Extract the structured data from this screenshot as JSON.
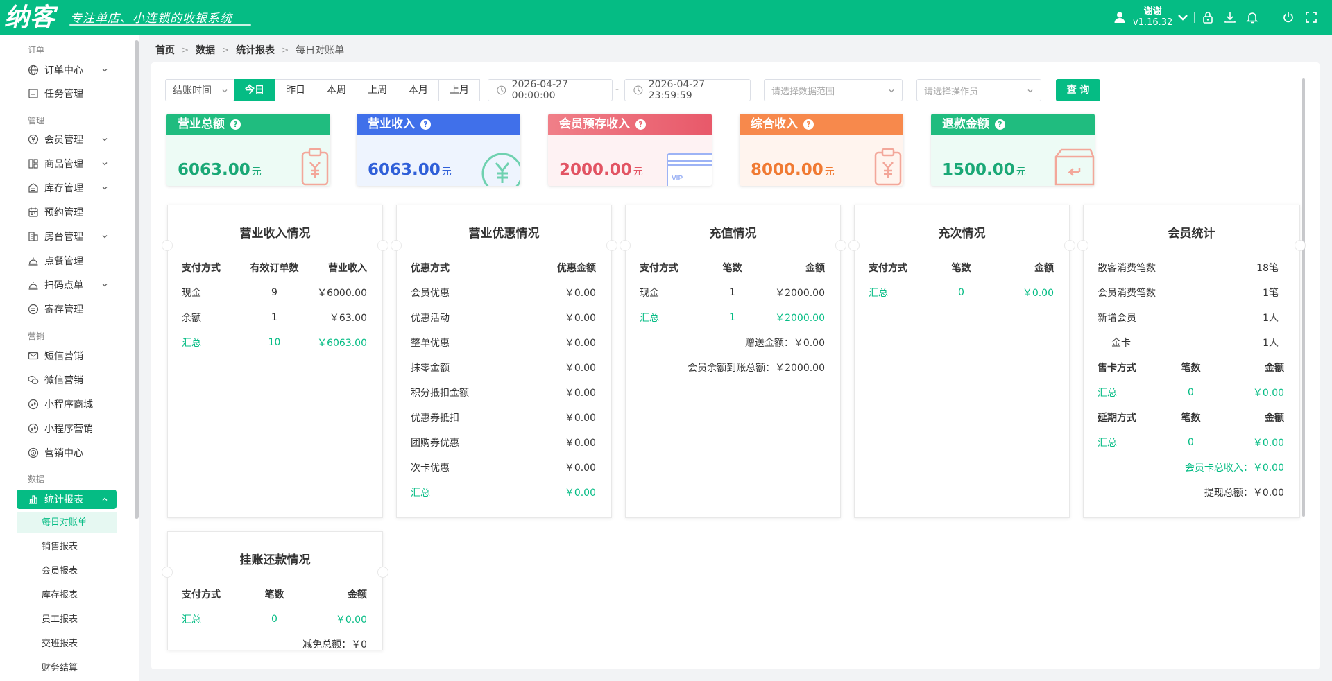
{
  "header": {
    "logo": "纳客",
    "slogan": "专注单店、小连锁的收银系统",
    "user": "谢谢",
    "version": "v1.16.32"
  },
  "sidebar": {
    "groups": [
      "订单",
      "管理",
      "营销",
      "数据"
    ],
    "items": [
      {
        "label": "订单中心",
        "icon": "globe-icon",
        "chevron": true
      },
      {
        "label": "任务管理",
        "icon": "task-icon",
        "chevron": false
      },
      {
        "label": "会员管理",
        "icon": "yen-icon",
        "chevron": true
      },
      {
        "label": "商品管理",
        "icon": "product-icon",
        "chevron": true
      },
      {
        "label": "库存管理",
        "icon": "warehouse-icon",
        "chevron": true
      },
      {
        "label": "预约管理",
        "icon": "calendar-icon",
        "chevron": false
      },
      {
        "label": "房台管理",
        "icon": "building-icon",
        "chevron": true
      },
      {
        "label": "点餐管理",
        "icon": "dining-icon",
        "chevron": false
      },
      {
        "label": "扫码点单",
        "icon": "dining-icon",
        "chevron": true
      },
      {
        "label": "寄存管理",
        "icon": "deposit-icon",
        "chevron": false
      },
      {
        "label": "短信营销",
        "icon": "mail-icon",
        "chevron": false
      },
      {
        "label": "微信营销",
        "icon": "wechat-icon",
        "chevron": false
      },
      {
        "label": "小程序商城",
        "icon": "miniprogram-icon",
        "chevron": false
      },
      {
        "label": "小程序营销",
        "icon": "miniprogram-icon",
        "chevron": false
      },
      {
        "label": "营销中心",
        "icon": "target-icon",
        "chevron": false
      },
      {
        "label": "统计报表",
        "icon": "chart-icon",
        "chevron": true
      }
    ],
    "subitems": [
      "每日对账单",
      "销售报表",
      "会员报表",
      "库存报表",
      "员工报表",
      "交班报表",
      "财务结算"
    ]
  },
  "breadcrumb": [
    "首页",
    "数据",
    "统计报表",
    "每日对账单"
  ],
  "filters": {
    "time_type": "结账时间",
    "ranges": [
      "今日",
      "昨日",
      "本周",
      "上周",
      "本月",
      "上月"
    ],
    "active_range": "今日",
    "start": "2026-04-27 00:00:00",
    "dash": "-",
    "end": "2026-04-27 23:59:59",
    "scope_placeholder": "请选择数据范围",
    "operator_placeholder": "请选择操作员",
    "query": "查 询"
  },
  "cards": [
    {
      "title": "营业总额",
      "value": "6063.00",
      "unit": "元",
      "color": "#20bc7f",
      "icon": "clipboard-yen-icon"
    },
    {
      "title": "营业收入",
      "value": "6063.00",
      "unit": "元",
      "color": "#4070ea",
      "icon": "yen-circle-icon"
    },
    {
      "title": "会员预存收入",
      "value": "2000.00",
      "unit": "元",
      "color": "#ec6a75",
      "icon": "vip-card-icon",
      "deco_text": "VIP"
    },
    {
      "title": "综合收入",
      "value": "8000.00",
      "unit": "元",
      "color": "#f7894c",
      "icon": "clipboard-yen-icon"
    },
    {
      "title": "退款金额",
      "value": "1500.00",
      "unit": "元",
      "color": "#20bc7f",
      "icon": "refund-box-icon"
    }
  ],
  "boxes": {
    "income": {
      "title": "营业收入情况",
      "headers": [
        "支付方式",
        "有效订单数",
        "营业收入"
      ],
      "rows": [
        [
          "现金",
          "9",
          "￥6000.00"
        ],
        [
          "余额",
          "1",
          "￥63.00"
        ]
      ],
      "total": [
        "汇总",
        "10",
        "￥6063.00"
      ]
    },
    "discount": {
      "title": "营业优惠情况",
      "headers": [
        "优惠方式",
        "优惠金额"
      ],
      "rows": [
        [
          "会员优惠",
          "￥0.00"
        ],
        [
          "优惠活动",
          "￥0.00"
        ],
        [
          "整单优惠",
          "￥0.00"
        ],
        [
          "抹零金额",
          "￥0.00"
        ],
        [
          "积分抵扣金额",
          "￥0.00"
        ],
        [
          "优惠券抵扣",
          "￥0.00"
        ],
        [
          "团购券优惠",
          "￥0.00"
        ],
        [
          "次卡优惠",
          "￥0.00"
        ]
      ],
      "total": [
        "汇总",
        "￥0.00"
      ]
    },
    "recharge": {
      "title": "充值情况",
      "headers": [
        "支付方式",
        "笔数",
        "金额"
      ],
      "rows": [
        [
          "现金",
          "1",
          "￥2000.00"
        ]
      ],
      "total": [
        "汇总",
        "1",
        "￥2000.00"
      ],
      "gift": "赠送金额：￥0.00",
      "arrival": "会员余额到账总额：￥2000.00"
    },
    "times": {
      "title": "充次情况",
      "headers": [
        "支付方式",
        "笔数",
        "金额"
      ],
      "total": [
        "汇总",
        "0",
        "￥0.00"
      ]
    },
    "member": {
      "title": "会员统计",
      "stats": [
        [
          "散客消费笔数",
          "18笔"
        ],
        [
          "会员消费笔数",
          "1笔"
        ],
        [
          "新增会员",
          "1人"
        ],
        [
          "金卡",
          "1人"
        ]
      ],
      "sell_headers": [
        "售卡方式",
        "笔数",
        "金额"
      ],
      "sell_total": [
        "汇总",
        "0",
        "￥0.00"
      ],
      "extend_headers": [
        "延期方式",
        "笔数",
        "金额"
      ],
      "extend_total": [
        "汇总",
        "0",
        "￥0.00"
      ],
      "card_income": "会员卡总收入：￥0.00",
      "withdraw": "提现总额：￥0.00"
    },
    "credit": {
      "title": "挂账还款情况",
      "headers": [
        "支付方式",
        "笔数",
        "金额"
      ],
      "total": [
        "汇总",
        "0",
        "￥0.00"
      ],
      "waive": "减免总额：￥0"
    }
  }
}
